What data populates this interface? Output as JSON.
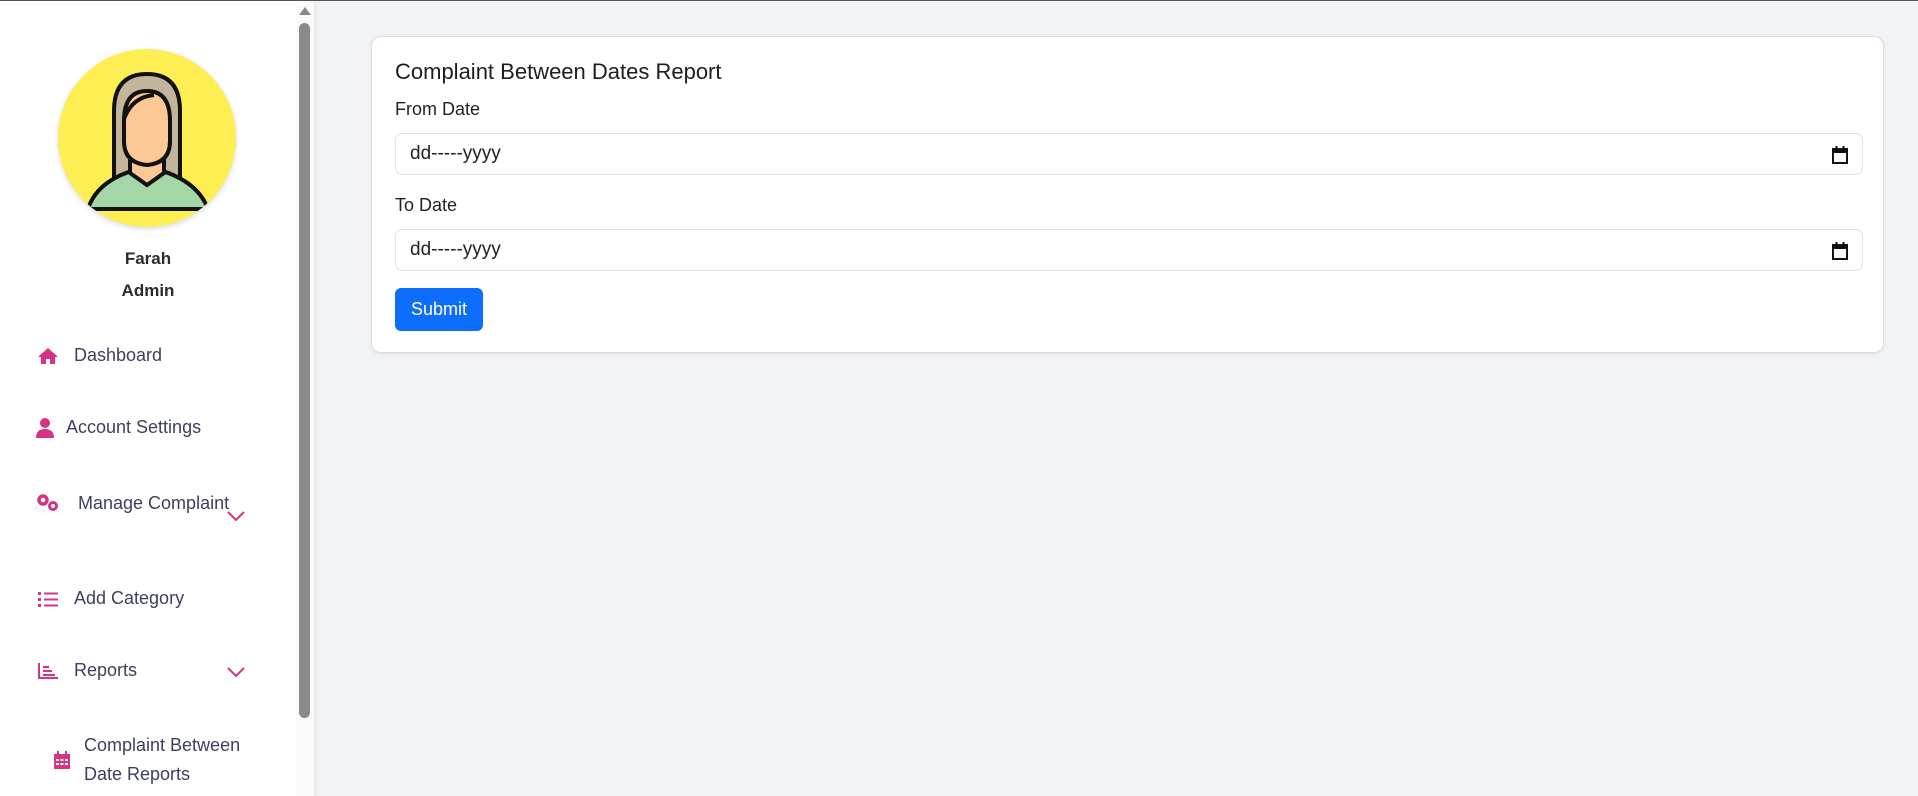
{
  "user": {
    "name": "Farah",
    "role": "Admin"
  },
  "sidebar": {
    "items": [
      {
        "label": "Dashboard",
        "icon": "home-icon"
      },
      {
        "label": "Account Settings",
        "icon": "user-icon"
      },
      {
        "label": "Manage Complaint",
        "icon": "gears-icon",
        "expandable": true
      },
      {
        "label": "Add Category",
        "icon": "list-icon"
      },
      {
        "label": "Reports",
        "icon": "chart-icon",
        "expandable": true
      },
      {
        "label": "Complaint Between Date Reports",
        "icon": "calendar-icon"
      }
    ],
    "accent": "#d63384"
  },
  "form": {
    "title": "Complaint Between Dates Report",
    "from_label": "From Date",
    "from_value": "dd-----yyyy",
    "to_label": "To Date",
    "to_value": "dd-----yyyy",
    "submit_label": "Submit",
    "button_color": "#0d6efd"
  }
}
